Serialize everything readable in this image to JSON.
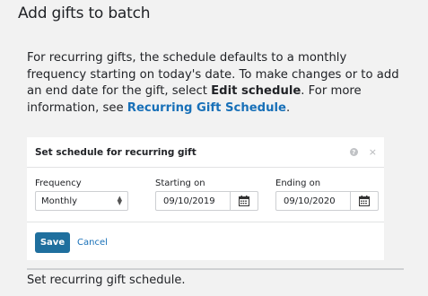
{
  "page": {
    "title": "Add gifts to batch",
    "intro_part1": "For recurring gifts, the schedule defaults to a monthly frequency starting on today's date. To make changes or to add an end date for the gift, select ",
    "intro_bold": "Edit schedule",
    "intro_part2": ". For more information, see ",
    "intro_link": "Recurring Gift Schedule",
    "intro_part3": ".",
    "caption": "Set recurring gift schedule."
  },
  "modal": {
    "title": "Set schedule for recurring gift",
    "help_icon": "question-circle-icon",
    "close_icon": "close-icon",
    "help_glyph": "?",
    "close_glyph": "×",
    "frequency": {
      "label": "Frequency",
      "value": "Monthly"
    },
    "starting": {
      "label": "Starting on",
      "value": "09/10/2019"
    },
    "ending": {
      "label": "Ending on",
      "value": "09/10/2020"
    },
    "save_label": "Save",
    "cancel_label": "Cancel"
  },
  "colors": {
    "primary_button": "#1f6f9e",
    "link": "#1870b8",
    "background": "#f2f2f2"
  }
}
